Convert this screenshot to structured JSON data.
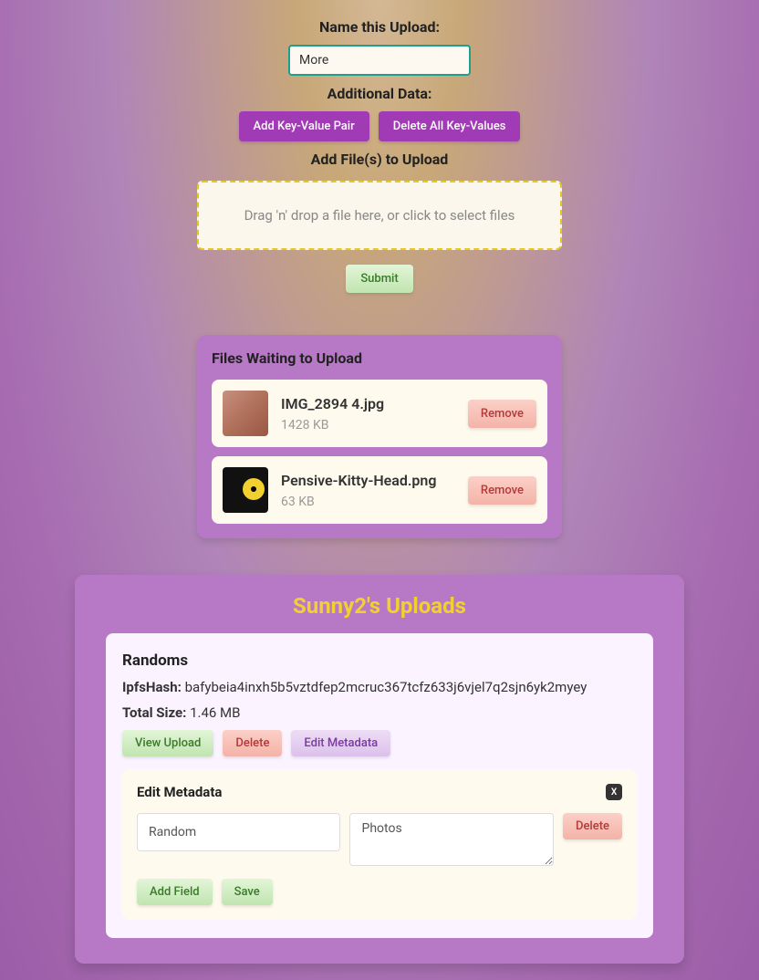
{
  "labels": {
    "name_upload": "Name this Upload:",
    "additional_data": "Additional Data:",
    "add_files": "Add File(s) to Upload",
    "dropzone": "Drag 'n' drop a file here, or click to select files",
    "files_waiting": "Files Waiting to Upload",
    "uploads_title": "Sunny2's Uploads",
    "edit_metadata_title": "Edit Metadata"
  },
  "inputs": {
    "name_value": "More"
  },
  "buttons": {
    "add_kv": "Add Key-Value Pair",
    "delete_kv": "Delete All Key-Values",
    "submit": "Submit",
    "remove": "Remove",
    "view_upload": "View Upload",
    "delete": "Delete",
    "edit_metadata": "Edit Metadata",
    "close": "X",
    "add_field": "Add Field",
    "save": "Save"
  },
  "waiting_files": [
    {
      "name": "IMG_2894 4.jpg",
      "size": "1428 KB"
    },
    {
      "name": "Pensive-Kitty-Head.png",
      "size": "63 KB"
    }
  ],
  "upload_entry": {
    "title": "Randoms",
    "hash_label": "IpfsHash:",
    "hash_value": "bafybeia4inxh5b5vztdfep2mcruc367tcfz633j6vjel7q2sjn6yk2myey",
    "size_label": "Total Size:",
    "size_value": "1.46 MB"
  },
  "metadata": {
    "key": "Random",
    "value": "Photos"
  }
}
